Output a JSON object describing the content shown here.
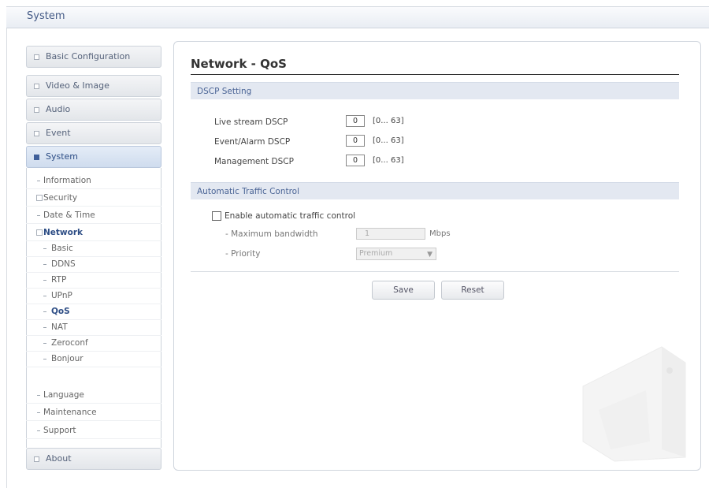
{
  "header": {
    "title": "System"
  },
  "sidebar": {
    "top_items": [
      {
        "label": "Basic Configuration"
      },
      {
        "label": "Video & Image"
      },
      {
        "label": "Audio"
      },
      {
        "label": "Event"
      },
      {
        "label": "System"
      }
    ],
    "system_items": [
      {
        "label": "Information"
      },
      {
        "label": "Security"
      },
      {
        "label": "Date & Time"
      },
      {
        "label": "Network"
      },
      {
        "label": "Basic"
      },
      {
        "label": "DDNS"
      },
      {
        "label": "RTP"
      },
      {
        "label": "UPnP"
      },
      {
        "label": "QoS"
      },
      {
        "label": "NAT"
      },
      {
        "label": "Zeroconf"
      },
      {
        "label": "Bonjour"
      },
      {
        "label": "Language"
      },
      {
        "label": "Maintenance"
      },
      {
        "label": "Support"
      }
    ],
    "about": {
      "label": "About"
    }
  },
  "main": {
    "title": "Network - QoS",
    "dscp": {
      "section_title": "DSCP Setting",
      "rows": [
        {
          "label": "Live stream DSCP",
          "value": "0",
          "range": "[0... 63]"
        },
        {
          "label": "Event/Alarm DSCP",
          "value": "0",
          "range": "[0... 63]"
        },
        {
          "label": "Management DSCP",
          "value": "0",
          "range": "[0... 63]"
        }
      ]
    },
    "traffic": {
      "section_title": "Automatic Traffic Control",
      "enable_label": "Enable automatic traffic control",
      "enabled": false,
      "bandwidth_label": "- Maximum bandwidth",
      "bandwidth_value": "1",
      "bandwidth_unit": "Mbps",
      "priority_label": "- Priority",
      "priority_value": "Premium"
    },
    "buttons": {
      "save": "Save",
      "reset": "Reset"
    }
  },
  "colors": {
    "accent": "#2d4d85",
    "section_bg": "#e3e8f1"
  }
}
